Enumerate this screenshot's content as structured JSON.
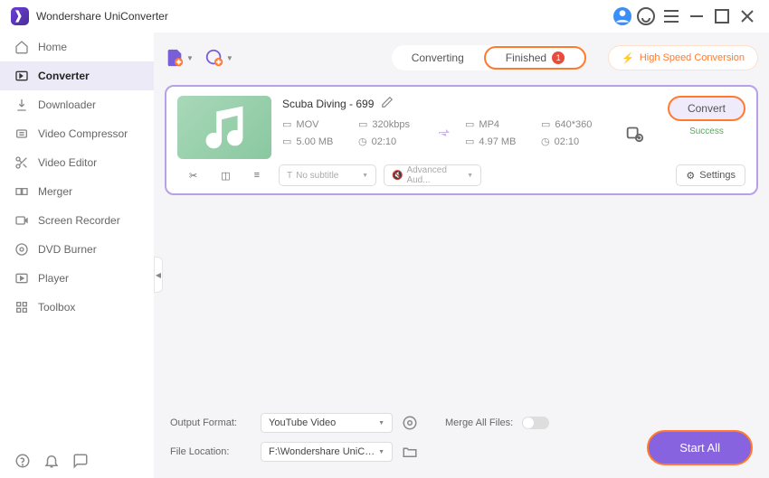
{
  "app": {
    "title": "Wondershare UniConverter"
  },
  "sidebar": {
    "items": [
      {
        "label": "Home"
      },
      {
        "label": "Converter"
      },
      {
        "label": "Downloader"
      },
      {
        "label": "Video Compressor"
      },
      {
        "label": "Video Editor"
      },
      {
        "label": "Merger"
      },
      {
        "label": "Screen Recorder"
      },
      {
        "label": "DVD Burner"
      },
      {
        "label": "Player"
      },
      {
        "label": "Toolbox"
      }
    ]
  },
  "tabs": {
    "converting": "Converting",
    "finished": "Finished",
    "finished_count": "1"
  },
  "hsc": {
    "label": "High Speed Conversion"
  },
  "card": {
    "title": "Scuba Diving - 699",
    "src": {
      "format": "MOV",
      "bitrate": "320kbps",
      "size": "5.00 MB",
      "duration": "02:10"
    },
    "dst": {
      "format": "MP4",
      "resolution": "640*360",
      "size": "4.97 MB",
      "duration": "02:10"
    },
    "subtitle_placeholder": "No subtitle",
    "audio_placeholder": "Advanced Aud...",
    "settings_label": "Settings",
    "convert_label": "Convert",
    "status": "Success"
  },
  "footer": {
    "output_format_label": "Output Format:",
    "output_format_value": "YouTube Video",
    "merge_label": "Merge All Files:",
    "file_location_label": "File Location:",
    "file_location_value": "F:\\Wondershare UniConverter",
    "start_all_label": "Start All"
  }
}
